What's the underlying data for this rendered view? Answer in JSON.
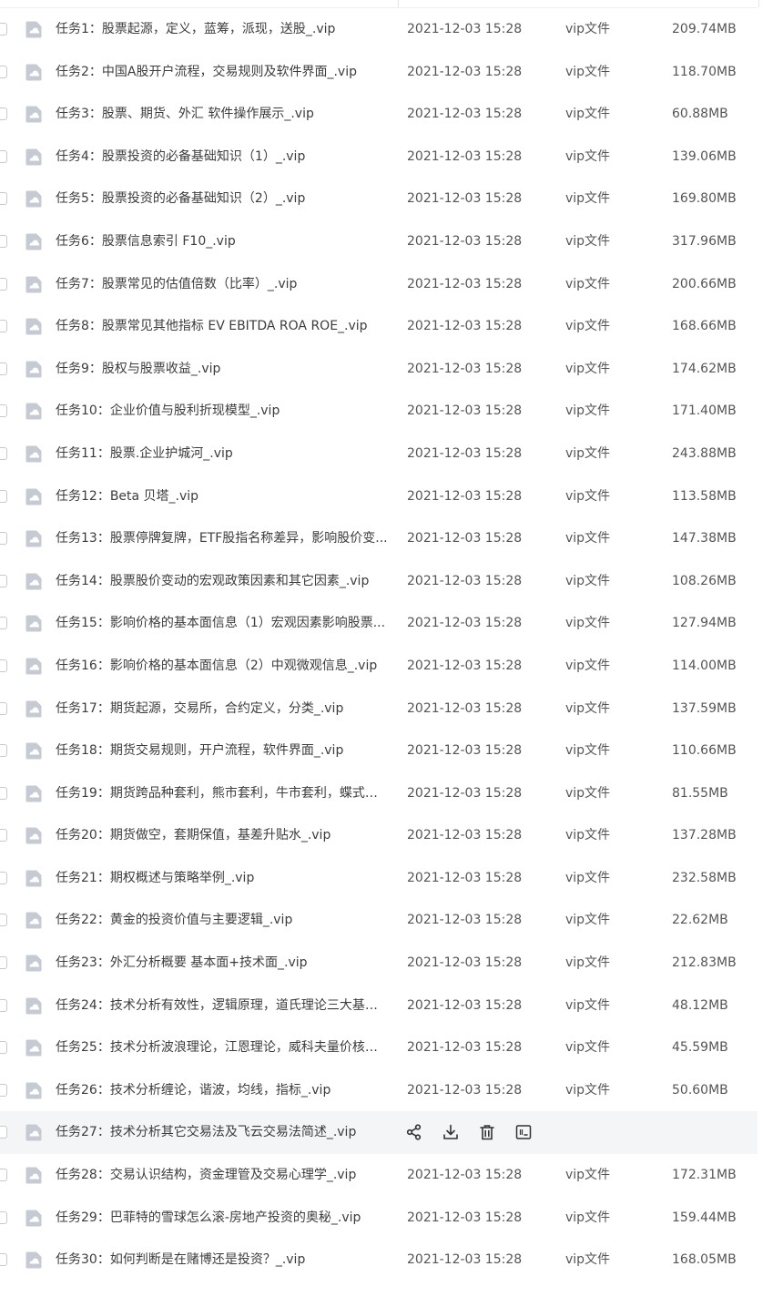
{
  "file_list": {
    "rows": [
      {
        "name": "任务1：股票起源，定义，蓝筹，派现，送股_.vip",
        "date": "2021-12-03 15:28",
        "type": "vip文件",
        "size": "209.74MB"
      },
      {
        "name": "任务2：中国A股开户流程，交易规则及软件界面_.vip",
        "date": "2021-12-03 15:28",
        "type": "vip文件",
        "size": "118.70MB"
      },
      {
        "name": "任务3：股票、期货、外汇 软件操作展示_.vip",
        "date": "2021-12-03 15:28",
        "type": "vip文件",
        "size": "60.88MB"
      },
      {
        "name": "任务4：股票投资的必备基础知识（1）_.vip",
        "date": "2021-12-03 15:28",
        "type": "vip文件",
        "size": "139.06MB"
      },
      {
        "name": "任务5：股票投资的必备基础知识（2）_.vip",
        "date": "2021-12-03 15:28",
        "type": "vip文件",
        "size": "169.80MB"
      },
      {
        "name": "任务6：股票信息索引 F10_.vip",
        "date": "2021-12-03 15:28",
        "type": "vip文件",
        "size": "317.96MB"
      },
      {
        "name": "任务7：股票常见的估值倍数（比率）_.vip",
        "date": "2021-12-03 15:28",
        "type": "vip文件",
        "size": "200.66MB"
      },
      {
        "name": "任务8：股票常见其他指标 EV EBITDA ROA ROE_.vip",
        "date": "2021-12-03 15:28",
        "type": "vip文件",
        "size": "168.66MB"
      },
      {
        "name": "任务9：股权与股票收益_.vip",
        "date": "2021-12-03 15:28",
        "type": "vip文件",
        "size": "174.62MB"
      },
      {
        "name": "任务10：企业价值与股利折现模型_.vip",
        "date": "2021-12-03 15:28",
        "type": "vip文件",
        "size": "171.40MB"
      },
      {
        "name": "任务11：股票.企业护城河_.vip",
        "date": "2021-12-03 15:28",
        "type": "vip文件",
        "size": "243.88MB"
      },
      {
        "name": "任务12：Beta 贝塔_.vip",
        "date": "2021-12-03 15:28",
        "type": "vip文件",
        "size": "113.58MB"
      },
      {
        "name": "任务13：股票停牌复牌，ETF股指名称差异，影响股价变...",
        "date": "2021-12-03 15:28",
        "type": "vip文件",
        "size": "147.38MB"
      },
      {
        "name": "任务14：股票股价变动的宏观政策因素和其它因素_.vip",
        "date": "2021-12-03 15:28",
        "type": "vip文件",
        "size": "108.26MB"
      },
      {
        "name": "任务15：影响价格的基本面信息（1）宏观因素影响股票...",
        "date": "2021-12-03 15:28",
        "type": "vip文件",
        "size": "127.94MB"
      },
      {
        "name": "任务16：影响价格的基本面信息（2）中观微观信息_.vip",
        "date": "2021-12-03 15:28",
        "type": "vip文件",
        "size": "114.00MB"
      },
      {
        "name": "任务17：期货起源，交易所，合约定义，分类_.vip",
        "date": "2021-12-03 15:28",
        "type": "vip文件",
        "size": "137.59MB"
      },
      {
        "name": "任务18：期货交易规则，开户流程，软件界面_.vip",
        "date": "2021-12-03 15:28",
        "type": "vip文件",
        "size": "110.66MB"
      },
      {
        "name": "任务19：期货跨品种套利，熊市套利，牛市套利，蝶式套...",
        "date": "2021-12-03 15:28",
        "type": "vip文件",
        "size": "81.55MB"
      },
      {
        "name": "任务20：期货做空，套期保值，基差升贴水_.vip",
        "date": "2021-12-03 15:28",
        "type": "vip文件",
        "size": "137.28MB"
      },
      {
        "name": "任务21：期权概述与策略举例_.vip",
        "date": "2021-12-03 15:28",
        "type": "vip文件",
        "size": "232.58MB"
      },
      {
        "name": "任务22：黄金的投资价值与主要逻辑_.vip",
        "date": "2021-12-03 15:28",
        "type": "vip文件",
        "size": "22.62MB"
      },
      {
        "name": "任务23：外汇分析概要 基本面+技术面_.vip",
        "date": "2021-12-03 15:28",
        "type": "vip文件",
        "size": "212.83MB"
      },
      {
        "name": "任务24：技术分析有效性，逻辑原理，道氏理论三大基石...",
        "date": "2021-12-03 15:28",
        "type": "vip文件",
        "size": "48.12MB"
      },
      {
        "name": "任务25：技术分析波浪理论，江恩理论，威科夫量价核心...",
        "date": "2021-12-03 15:28",
        "type": "vip文件",
        "size": "45.59MB"
      },
      {
        "name": "任务26：技术分析缠论，谐波，均线，指标_.vip",
        "date": "2021-12-03 15:28",
        "type": "vip文件",
        "size": "50.60MB"
      },
      {
        "name": "任务27：技术分析其它交易法及飞云交易法简述_.vip",
        "date": "",
        "type": "",
        "size": "",
        "hovered": true
      },
      {
        "name": "任务28：交易认识结构，资金理管及交易心理学_.vip",
        "date": "2021-12-03 15:28",
        "type": "vip文件",
        "size": "172.31MB"
      },
      {
        "name": "任务29：巴菲特的雪球怎么滚-房地产投资的奥秘_.vip",
        "date": "2021-12-03 15:28",
        "type": "vip文件",
        "size": "159.44MB"
      },
      {
        "name": "任务30：如何判断是在赌博还是投资？_.vip",
        "date": "2021-12-03 15:28",
        "type": "vip文件",
        "size": "168.05MB"
      }
    ],
    "row_icon": "file-icon",
    "hover_actions": [
      "share-icon",
      "download-icon",
      "delete-icon",
      "rename-icon"
    ]
  },
  "colors": {
    "text": "#3c3c3c",
    "muted_text": "#555555",
    "hover_background": "#f4f5f7",
    "file_icon": "#c6cbd3"
  }
}
